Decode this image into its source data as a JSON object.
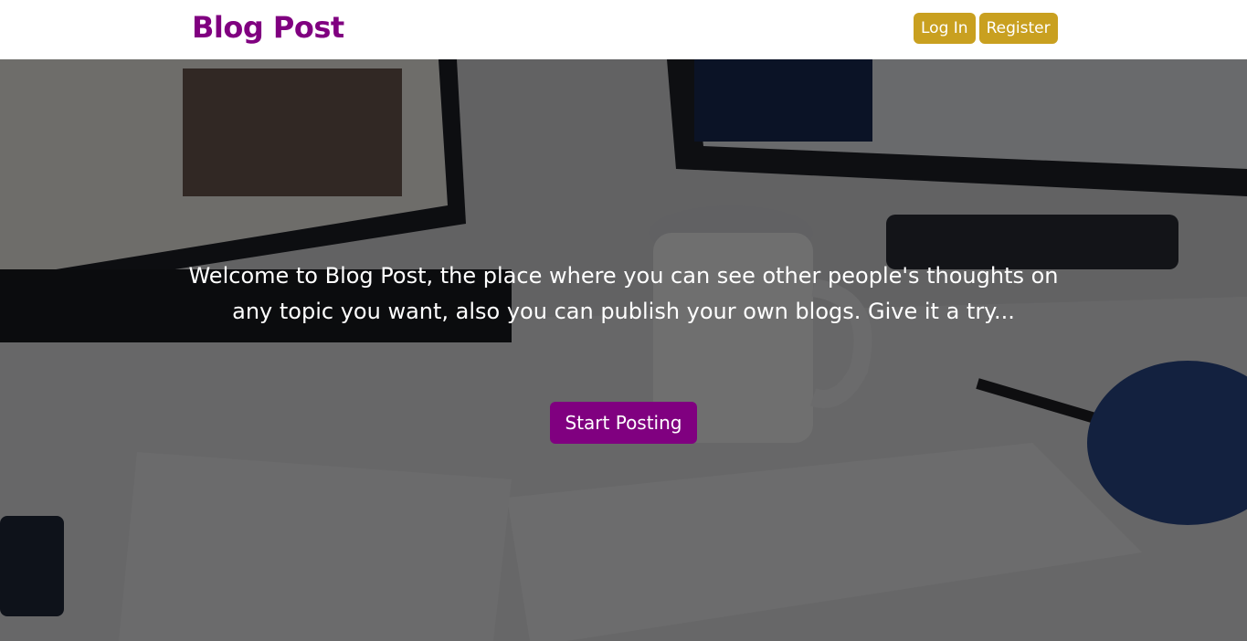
{
  "navbar": {
    "brand": "Blog Post",
    "login_label": "Log In",
    "register_label": "Register"
  },
  "hero": {
    "message": "Welcome to Blog Post, the place where you can see other people's thoughts on any topic you want, also you can publish your own blogs. Give it a try...",
    "cta_label": "Start Posting",
    "background_image": "desk-workspace-photo"
  },
  "colors": {
    "brand": "#800080",
    "nav_button": "#c9a020",
    "cta_button": "#800080"
  }
}
